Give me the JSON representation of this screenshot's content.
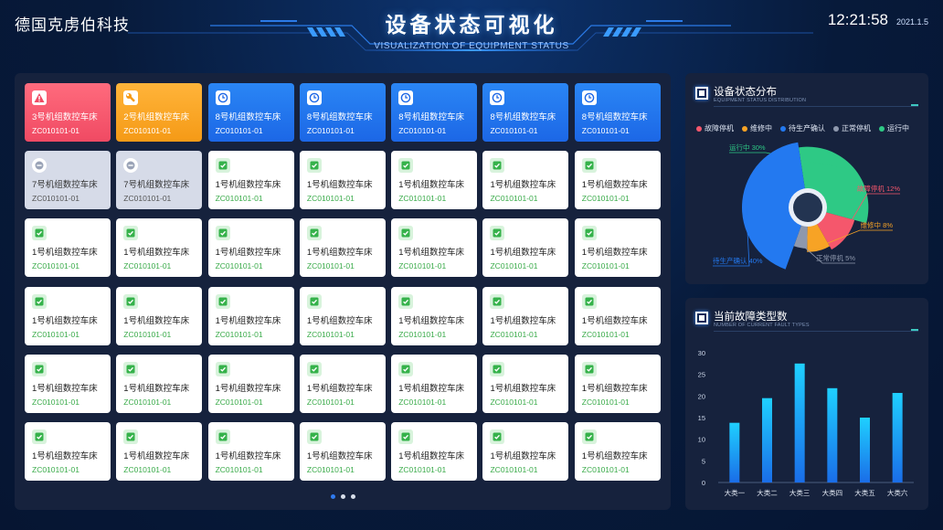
{
  "header": {
    "company": "德国克虏伯科技",
    "title": "设备状态可视化",
    "subtitle": "VISUALIZATION OF EQUIPMENT STATUS",
    "time": "12:21:58",
    "date": "2021.1.5"
  },
  "status_colors": {
    "fault": "#f5576c",
    "repair": "#f7a325",
    "pending": "#2379f0",
    "stop": "#d6dbe8",
    "run": "#ffffff"
  },
  "machines": [
    {
      "name": "3号机组数控车床",
      "code": "ZC010101-01",
      "status": "fault",
      "icon": "warning-icon"
    },
    {
      "name": "2号机组数控车床",
      "code": "ZC010101-01",
      "status": "repair",
      "icon": "wrench-icon"
    },
    {
      "name": "8号机组数控车床",
      "code": "ZC010101-01",
      "status": "pending",
      "icon": "clock-icon"
    },
    {
      "name": "8号机组数控车床",
      "code": "ZC010101-01",
      "status": "pending",
      "icon": "clock-icon"
    },
    {
      "name": "8号机组数控车床",
      "code": "ZC010101-01",
      "status": "pending",
      "icon": "clock-icon"
    },
    {
      "name": "8号机组数控车床",
      "code": "ZC010101-01",
      "status": "pending",
      "icon": "clock-icon"
    },
    {
      "name": "8号机组数控车床",
      "code": "ZC010101-01",
      "status": "pending",
      "icon": "clock-icon"
    },
    {
      "name": "7号机组数控车床",
      "code": "ZC010101-01",
      "status": "stop",
      "icon": "minus-circle-icon"
    },
    {
      "name": "7号机组数控车床",
      "code": "ZC010101-01",
      "status": "stop",
      "icon": "minus-circle-icon"
    },
    {
      "name": "1号机组数控车床",
      "code": "ZC010101-01",
      "status": "run",
      "icon": "check-icon"
    },
    {
      "name": "1号机组数控车床",
      "code": "ZC010101-01",
      "status": "run",
      "icon": "check-icon"
    },
    {
      "name": "1号机组数控车床",
      "code": "ZC010101-01",
      "status": "run",
      "icon": "check-icon"
    },
    {
      "name": "1号机组数控车床",
      "code": "ZC010101-01",
      "status": "run",
      "icon": "check-icon"
    },
    {
      "name": "1号机组数控车床",
      "code": "ZC010101-01",
      "status": "run",
      "icon": "check-icon"
    },
    {
      "name": "1号机组数控车床",
      "code": "ZC010101-01",
      "status": "run",
      "icon": "check-icon"
    },
    {
      "name": "1号机组数控车床",
      "code": "ZC010101-01",
      "status": "run",
      "icon": "check-icon"
    },
    {
      "name": "1号机组数控车床",
      "code": "ZC010101-01",
      "status": "run",
      "icon": "check-icon"
    },
    {
      "name": "1号机组数控车床",
      "code": "ZC010101-01",
      "status": "run",
      "icon": "check-icon"
    },
    {
      "name": "1号机组数控车床",
      "code": "ZC010101-01",
      "status": "run",
      "icon": "check-icon"
    },
    {
      "name": "1号机组数控车床",
      "code": "ZC010101-01",
      "status": "run",
      "icon": "check-icon"
    },
    {
      "name": "1号机组数控车床",
      "code": "ZC010101-01",
      "status": "run",
      "icon": "check-icon"
    },
    {
      "name": "1号机组数控车床",
      "code": "ZC010101-01",
      "status": "run",
      "icon": "check-icon"
    },
    {
      "name": "1号机组数控车床",
      "code": "ZC010101-01",
      "status": "run",
      "icon": "check-icon"
    },
    {
      "name": "1号机组数控车床",
      "code": "ZC010101-01",
      "status": "run",
      "icon": "check-icon"
    },
    {
      "name": "1号机组数控车床",
      "code": "ZC010101-01",
      "status": "run",
      "icon": "check-icon"
    },
    {
      "name": "1号机组数控车床",
      "code": "ZC010101-01",
      "status": "run",
      "icon": "check-icon"
    },
    {
      "name": "1号机组数控车床",
      "code": "ZC010101-01",
      "status": "run",
      "icon": "check-icon"
    },
    {
      "name": "1号机组数控车床",
      "code": "ZC010101-01",
      "status": "run",
      "icon": "check-icon"
    },
    {
      "name": "1号机组数控车床",
      "code": "ZC010101-01",
      "status": "run",
      "icon": "check-icon"
    },
    {
      "name": "1号机组数控车床",
      "code": "ZC010101-01",
      "status": "run",
      "icon": "check-icon"
    },
    {
      "name": "1号机组数控车床",
      "code": "ZC010101-01",
      "status": "run",
      "icon": "check-icon"
    },
    {
      "name": "1号机组数控车床",
      "code": "ZC010101-01",
      "status": "run",
      "icon": "check-icon"
    },
    {
      "name": "1号机组数控车床",
      "code": "ZC010101-01",
      "status": "run",
      "icon": "check-icon"
    },
    {
      "name": "1号机组数控车床",
      "code": "ZC010101-01",
      "status": "run",
      "icon": "check-icon"
    },
    {
      "name": "1号机组数控车床",
      "code": "ZC010101-01",
      "status": "run",
      "icon": "check-icon"
    },
    {
      "name": "1号机组数控车床",
      "code": "ZC010101-01",
      "status": "run",
      "icon": "check-icon"
    },
    {
      "name": "1号机组数控车床",
      "code": "ZC010101-01",
      "status": "run",
      "icon": "check-icon"
    },
    {
      "name": "1号机组数控车床",
      "code": "ZC010101-01",
      "status": "run",
      "icon": "check-icon"
    },
    {
      "name": "1号机组数控车床",
      "code": "ZC010101-01",
      "status": "run",
      "icon": "check-icon"
    },
    {
      "name": "1号机组数控车床",
      "code": "ZC010101-01",
      "status": "run",
      "icon": "check-icon"
    },
    {
      "name": "1号机组数控车床",
      "code": "ZC010101-01",
      "status": "run",
      "icon": "check-icon"
    },
    {
      "name": "1号机组数控车床",
      "code": "ZC010101-01",
      "status": "run",
      "icon": "check-icon"
    }
  ],
  "pagination": {
    "pages": 3,
    "current": 0
  },
  "status_panel": {
    "title": "设备状态分布",
    "subtitle": "EQUIPMENT STATUS DISTRIBUTION"
  },
  "fault_panel": {
    "title": "当前故障类型数",
    "subtitle": "NUMBER OF CURRENT FAULT TYPES"
  },
  "chart_data": [
    {
      "type": "pie",
      "variant": "rose",
      "title": "",
      "legend": [
        "故障停机",
        "维修中",
        "待生产确认",
        "正常停机",
        "运行中"
      ],
      "slices": [
        {
          "label": "运行中",
          "value": 30,
          "display": "运行中 30%",
          "color": "#2ec985"
        },
        {
          "label": "故障停机",
          "value": 12,
          "display": "故障停机 12%",
          "color": "#f5576c"
        },
        {
          "label": "维修中",
          "value": 8,
          "display": "维修中 8%",
          "color": "#f7a325"
        },
        {
          "label": "正常停机",
          "value": 5,
          "display": "正常停机 5%",
          "color": "#8e98ad"
        },
        {
          "label": "待生产确认",
          "value": 40,
          "display": "待生产确认 40%",
          "color": "#2379f0"
        }
      ],
      "legend_position": "top"
    },
    {
      "type": "bar",
      "title": "",
      "categories": [
        "大类一",
        "大类二",
        "大类三",
        "大类四",
        "大类五",
        "大类六"
      ],
      "values": [
        13.8,
        19.5,
        27.5,
        21.8,
        15,
        20.7
      ],
      "ylim": [
        0,
        30
      ],
      "yticks": [
        0,
        5,
        10,
        15,
        20,
        25,
        30
      ],
      "grid": false,
      "color": "#19a8f5"
    }
  ]
}
